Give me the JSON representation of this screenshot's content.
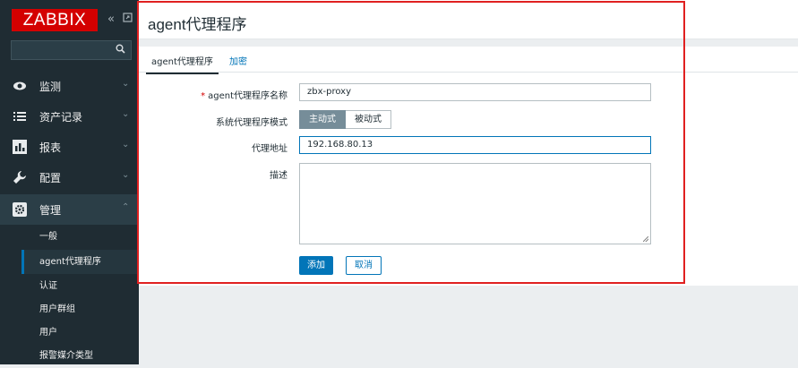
{
  "app": {
    "logo": "ZABBIX"
  },
  "sidebar": {
    "collapse_icon": "double-chevron-left-icon",
    "kiosk_icon": "kiosk-icon",
    "search": {
      "placeholder": "",
      "icon": "search-icon"
    },
    "menu": [
      {
        "label": "监测",
        "icon": "eye-icon",
        "expanded": false
      },
      {
        "label": "资产记录",
        "icon": "list-icon",
        "expanded": false
      },
      {
        "label": "报表",
        "icon": "bar-chart-icon",
        "expanded": false
      },
      {
        "label": "配置",
        "icon": "wrench-icon",
        "expanded": false
      },
      {
        "label": "管理",
        "icon": "gear-icon",
        "expanded": true
      }
    ],
    "submenu": [
      {
        "label": "一般"
      },
      {
        "label": "agent代理程序",
        "active": true
      },
      {
        "label": "认证"
      },
      {
        "label": "用户群组"
      },
      {
        "label": "用户"
      },
      {
        "label": "报警媒介类型"
      }
    ]
  },
  "page": {
    "title": "agent代理程序"
  },
  "tabs": [
    {
      "label": "agent代理程序",
      "active": true
    },
    {
      "label": "加密",
      "active": false
    }
  ],
  "form": {
    "name": {
      "label": "agent代理程序名称",
      "required": true,
      "value": "zbx-proxy"
    },
    "mode": {
      "label": "系统代理程序模式",
      "options": [
        "主动式",
        "被动式"
      ],
      "selected": "主动式"
    },
    "address": {
      "label": "代理地址",
      "value": "192.168.80.13"
    },
    "description": {
      "label": "描述",
      "value": ""
    },
    "buttons": {
      "add": "添加",
      "cancel": "取消"
    }
  },
  "colors": {
    "brand": "#d40000",
    "accent": "#0275b8",
    "sidebar_bg": "#1f2c33",
    "annotation": "#e02020"
  }
}
